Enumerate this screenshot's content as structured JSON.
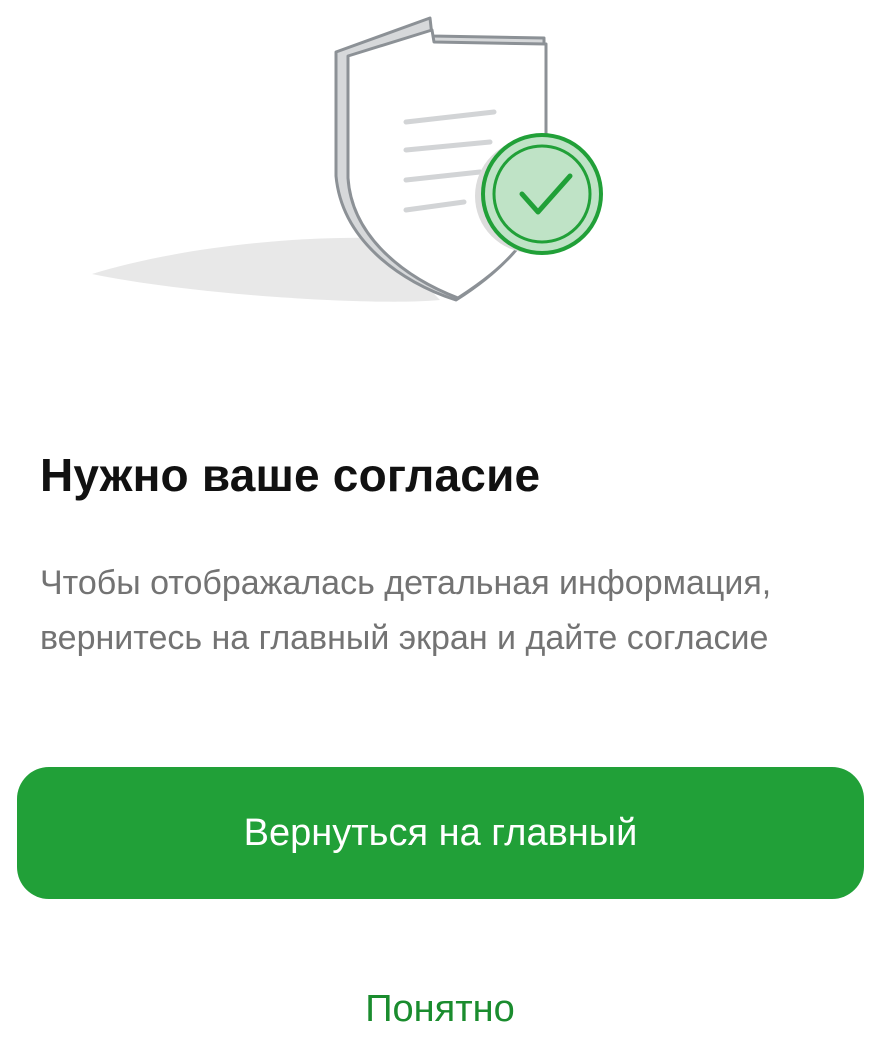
{
  "illustration": {
    "icon": "shield-check-icon",
    "accent_color": "#21a038"
  },
  "dialog": {
    "title": "Нужно ваше согласие",
    "description": "Чтобы отображалась детальная информация, вернитесь на главный экран и дайте согласие"
  },
  "actions": {
    "primary_label": "Вернуться на главный",
    "secondary_label": "Понятно"
  },
  "colors": {
    "primary": "#21a038",
    "link": "#1a8c2e",
    "text": "#111111",
    "muted": "#737373"
  }
}
